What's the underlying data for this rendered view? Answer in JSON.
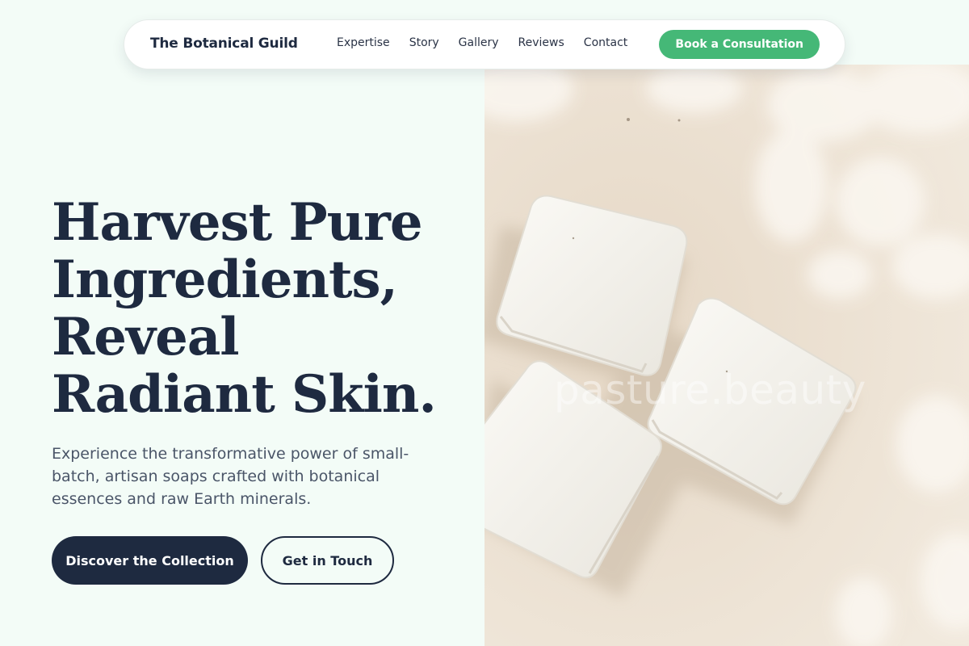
{
  "brand": {
    "name": "The Botanical Guild"
  },
  "nav": {
    "links": [
      "Expertise",
      "Story",
      "Gallery",
      "Reviews",
      "Contact"
    ],
    "cta_label": "Book a Consultation"
  },
  "hero": {
    "title_lines": [
      "Harvest Pure",
      "Ingredients,",
      "Reveal",
      "Radiant Skin."
    ],
    "subtitle": "Experience the transformative power of small-batch, artisan soaps crafted with botanical essences and raw Earth minerals.",
    "primary_button": "Discover the Collection",
    "secondary_button": "Get in Touch"
  },
  "image": {
    "watermark": "pasture.beauty"
  },
  "colors": {
    "background": "#f3fcf7",
    "navy": "#1e2a40",
    "accent_green": "#45b877",
    "image_bg": "#ede2d4"
  }
}
